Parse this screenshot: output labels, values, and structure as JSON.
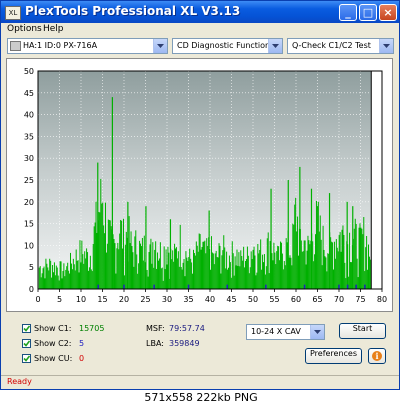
{
  "window": {
    "title": "PlexTools Professional XL V3.13",
    "app_icon_text": "XL",
    "minimize": "_",
    "maximize": "□",
    "close": "×"
  },
  "menu": [
    "Options",
    "Help"
  ],
  "toolbar": {
    "drive": "HA:1 ID:0  PX-716A",
    "function": "CD Diagnostic Functions",
    "test": "Q-Check C1/C2 Test"
  },
  "chart_data": {
    "type": "bar",
    "xlim": [
      0,
      80
    ],
    "ylim": [
      0,
      50
    ],
    "x_ticks": [
      "0",
      "5",
      "10",
      "15",
      "20",
      "25",
      "30",
      "35",
      "40",
      "45",
      "50",
      "55",
      "60",
      "65",
      "70",
      "75",
      "80"
    ],
    "y_ticks": [
      "0",
      "5",
      "10",
      "15",
      "20",
      "25",
      "30",
      "35",
      "40",
      "45",
      "50"
    ],
    "grid": true,
    "series": [
      {
        "color": "#00b000",
        "peaks": [
          [
            1,
            7
          ],
          [
            3,
            8
          ],
          [
            6,
            6
          ],
          [
            8,
            9
          ],
          [
            10,
            12
          ],
          [
            12,
            10
          ],
          [
            14,
            24
          ],
          [
            15,
            30
          ],
          [
            16,
            20
          ],
          [
            17,
            15
          ],
          [
            18,
            14
          ],
          [
            19,
            20
          ],
          [
            20,
            16
          ],
          [
            21,
            18
          ],
          [
            22,
            12
          ],
          [
            23,
            15
          ],
          [
            24,
            12
          ],
          [
            25,
            14
          ],
          [
            26,
            11
          ],
          [
            27,
            17
          ],
          [
            28,
            13
          ],
          [
            29,
            11
          ],
          [
            30,
            15
          ],
          [
            31,
            10
          ],
          [
            32,
            11
          ],
          [
            33,
            16
          ],
          [
            34,
            12
          ],
          [
            35,
            10
          ],
          [
            36,
            9
          ],
          [
            37,
            12
          ],
          [
            38,
            14
          ],
          [
            39,
            11
          ],
          [
            40,
            14
          ],
          [
            41,
            9
          ],
          [
            42,
            11
          ],
          [
            43,
            13
          ],
          [
            44,
            10
          ],
          [
            45,
            11
          ],
          [
            46,
            12
          ],
          [
            47,
            9
          ],
          [
            48,
            11
          ],
          [
            49,
            10
          ],
          [
            50,
            14
          ],
          [
            51,
            12
          ],
          [
            52,
            12
          ],
          [
            53,
            13
          ],
          [
            54,
            15
          ],
          [
            55,
            12
          ],
          [
            56,
            10
          ],
          [
            57,
            13
          ],
          [
            58,
            14
          ],
          [
            59,
            12
          ],
          [
            60,
            26
          ],
          [
            61,
            14
          ],
          [
            62,
            15
          ],
          [
            63,
            13
          ],
          [
            64,
            18
          ],
          [
            65,
            22
          ],
          [
            66,
            16
          ],
          [
            67,
            14
          ],
          [
            68,
            13
          ],
          [
            69,
            16
          ],
          [
            70,
            17
          ],
          [
            71,
            18
          ],
          [
            72,
            15
          ],
          [
            73,
            18
          ],
          [
            74,
            16
          ],
          [
            75,
            15
          ],
          [
            76,
            18
          ],
          [
            77,
            12
          ]
        ],
        "spikes": [
          [
            17.3,
            44
          ],
          [
            13.9,
            29
          ],
          [
            60.9,
            28
          ],
          [
            58.2,
            25
          ],
          [
            71.9,
            20
          ],
          [
            73.2,
            19
          ],
          [
            54.2,
            23
          ],
          [
            63.6,
            23
          ],
          [
            67.8,
            22
          ],
          [
            20.9,
            20
          ],
          [
            25.1,
            19
          ],
          [
            39.8,
            18
          ],
          [
            30.8,
            16
          ]
        ]
      },
      {
        "color": "#2020c0",
        "points": [
          [
            14,
            1
          ],
          [
            20,
            1
          ],
          [
            27,
            1
          ],
          [
            35,
            1
          ],
          [
            44,
            1
          ],
          [
            53,
            1
          ],
          [
            62,
            1
          ],
          [
            70,
            1
          ],
          [
            72,
            1
          ],
          [
            74,
            1
          ],
          [
            76,
            1
          ]
        ]
      }
    ]
  },
  "stats": {
    "show_c1": "Show C1:",
    "c1_value": "15705",
    "show_c2": "Show C2:",
    "c2_value": "5",
    "show_cu": "Show CU:",
    "cu_value": "0",
    "msf_label": "MSF:",
    "msf_value": "79:57.74",
    "lba_label": "LBA:",
    "lba_value": "359849",
    "speed": "10-24 X CAV",
    "start": "Start",
    "preferences": "Preferences",
    "info_icon_glyph": "i"
  },
  "status": "Ready",
  "caption": "571x558  222kb  PNG"
}
